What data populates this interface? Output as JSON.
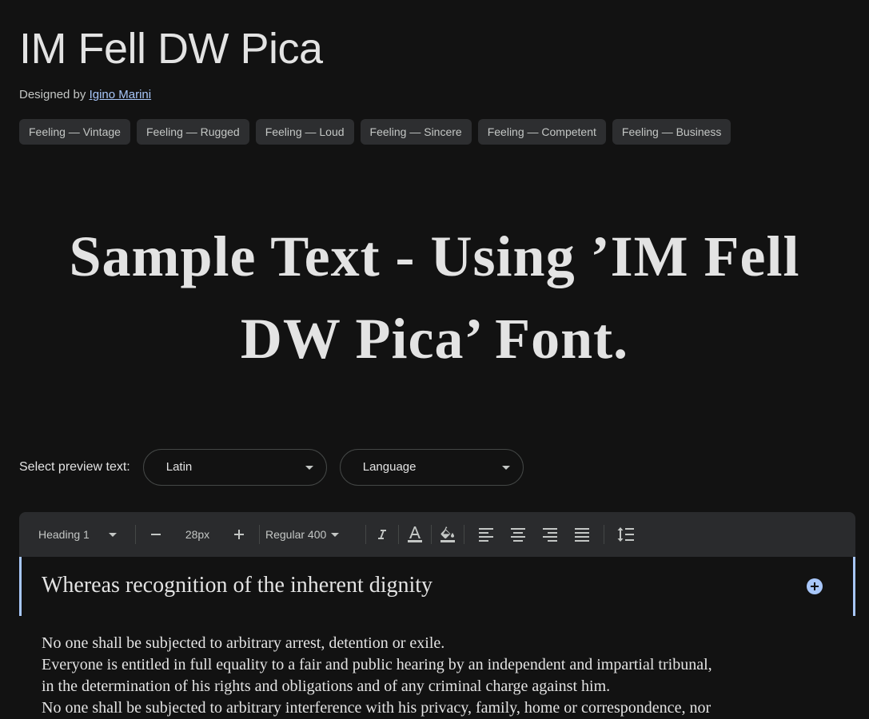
{
  "font": {
    "name": "IM Fell DW Pica",
    "designed_by_label": "Designed by",
    "designer": "Igino Marini"
  },
  "tags": [
    "Feeling — Vintage",
    "Feeling — Rugged",
    "Feeling — Loud",
    "Feeling — Sincere",
    "Feeling — Competent",
    "Feeling — Business"
  ],
  "sample_text": "Sample Text - Using ’IM Fell DW Pica’ Font.",
  "preview": {
    "label": "Select preview text:",
    "script_select": "Latin",
    "language_select": "Language"
  },
  "toolbar": {
    "style": "Heading 1",
    "size": "28px",
    "weight": "Regular 400",
    "icons": [
      "minus-icon",
      "plus-icon",
      "italic-icon",
      "text-color-icon",
      "highlight-color-icon",
      "align-left-icon",
      "align-center-icon",
      "align-right-icon",
      "align-justify-icon",
      "line-spacing-icon"
    ]
  },
  "editor": {
    "heading": "Whereas recognition of the inherent dignity",
    "paragraph_lines": [
      "No one shall be subjected to arbitrary arrest, detention or exile.",
      "Everyone is entitled in full equality to a fair and public hearing by an independent and impartial tribunal,",
      "in the determination of his rights and obligations and of any criminal charge against him.",
      "No one shall be subjected to arbitrary interference with his privacy, family, home or correspondence, nor"
    ]
  },
  "colors": {
    "background": "#121212",
    "surface": "#2a2b2d",
    "accent": "#a8c7fa",
    "text": "#e3e3e3"
  }
}
